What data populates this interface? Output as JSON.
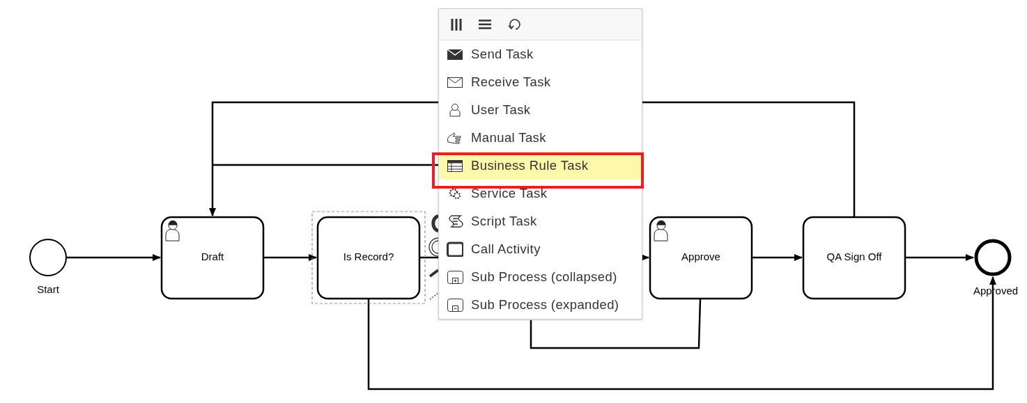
{
  "diagram": {
    "nodes": [
      {
        "kind": "start",
        "label": "Start",
        "selected": false
      },
      {
        "kind": "user_task",
        "label": "Draft",
        "selected": false
      },
      {
        "kind": "task",
        "label": "Is Record?",
        "selected": true
      },
      {
        "kind": "user_task",
        "label": "Approve",
        "selected": false
      },
      {
        "kind": "task",
        "label": "QA Sign Off",
        "selected": false
      },
      {
        "kind": "end",
        "label": "Approved",
        "selected": false
      }
    ]
  },
  "replace_menu": {
    "toolbar": [
      {
        "kind": "columns"
      },
      {
        "kind": "lines"
      },
      {
        "kind": "loop"
      }
    ],
    "items": [
      {
        "kind": "send",
        "label": "Send Task",
        "selected": false
      },
      {
        "kind": "receive",
        "label": "Receive Task",
        "selected": false
      },
      {
        "kind": "user",
        "label": "User Task",
        "selected": false
      },
      {
        "kind": "manual",
        "label": "Manual Task",
        "selected": false
      },
      {
        "kind": "rule",
        "label": "Business Rule Task",
        "selected": true
      },
      {
        "kind": "service",
        "label": "Service Task",
        "selected": false
      },
      {
        "kind": "script",
        "label": "Script Task",
        "selected": false
      },
      {
        "kind": "call",
        "label": "Call Activity",
        "selected": false
      },
      {
        "kind": "sub_collapsed",
        "label": "Sub Process (collapsed)",
        "selected": false
      },
      {
        "kind": "sub_expanded",
        "label": "Sub Process (expanded)",
        "selected": false
      }
    ]
  }
}
